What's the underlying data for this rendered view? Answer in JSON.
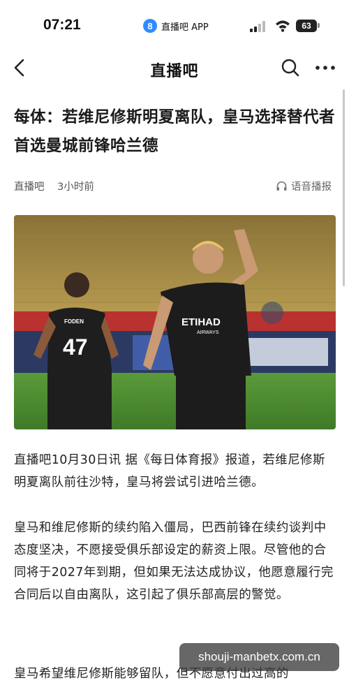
{
  "status_bar": {
    "time": "07:21",
    "app_icon_label": "8",
    "app_name": "直播吧 APP",
    "battery": "63"
  },
  "nav": {
    "title": "直播吧",
    "back_icon": "chevron-left-icon",
    "search_icon": "search-icon",
    "more_icon": "more-dots-icon"
  },
  "article": {
    "title": "每体：若维尼修斯明夏离队，皇马选择替代者首选曼城前锋哈兰德",
    "source": "直播吧",
    "time_ago": "3小时前",
    "tts_label": "语音播报",
    "photo": {
      "jersey_name": "FODEN",
      "jersey_number": "47",
      "sponsor": "ETIHAD",
      "sponsor_sub": "AIRWAYS"
    },
    "paragraphs": [
      "直播吧10月30日讯  据《每日体育报》报道，若维尼修斯明夏离队前往沙特，皇马将尝试引进哈兰德。",
      "皇马和维尼修斯的续约陷入僵局，巴西前锋在续约谈判中态度坚决，不愿接受俱乐部设定的薪资上限。尽管他的合同将于2027年到期，但如果无法达成协议，他愿意履行完合同后以自由离队，这引起了俱乐部高层的警觉。",
      "皇马希望维尼修斯能够留队，但不愿意付出过高的"
    ]
  },
  "watermark": "shouji-manbetx.com.cn",
  "colors": {
    "accent": "#2f8cff",
    "text": "#222222",
    "meta": "#555555"
  }
}
